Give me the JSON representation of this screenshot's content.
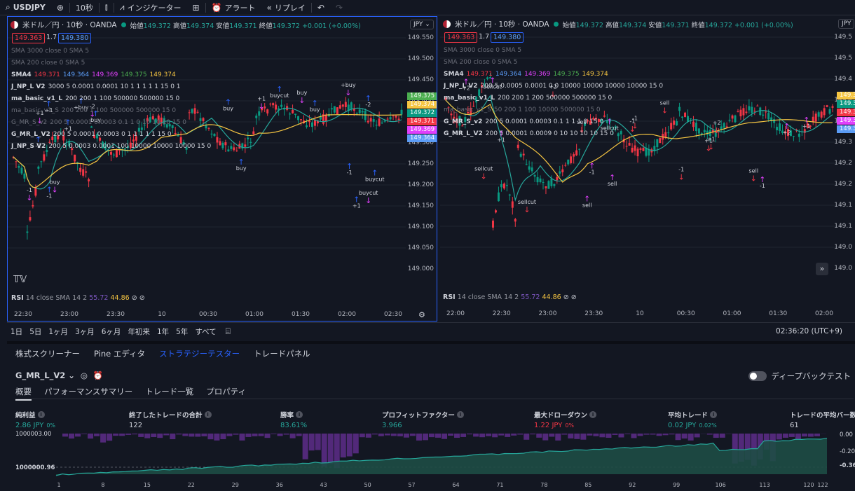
{
  "toolbar": {
    "symbol": "USDJPY",
    "interval": "10秒",
    "indicators": "インジケーター",
    "alert": "アラート",
    "replay": "リプレイ"
  },
  "left_pane": {
    "title": "米ドル／円 · 10秒 · OANDA",
    "ohlc": {
      "open_label": "始値",
      "open": "149.372",
      "high_label": "高値",
      "high": "149.374",
      "low_label": "安値",
      "low": "149.371",
      "close_label": "終値",
      "close": "149.372",
      "change": "+0.001 (+0.00%)"
    },
    "bid": "149.363",
    "spread": "1.7",
    "ask": "149.380",
    "currency": "JPY",
    "legend": [
      {
        "name": "SMA 3000 close 0 SMA 5",
        "dim": true
      },
      {
        "name": "SMA 200 close 0 SMA 5",
        "dim": true
      },
      {
        "name": "SMA4",
        "values": [
          "149.371",
          "149.364",
          "149.369",
          "149.375",
          "149.374"
        ]
      },
      {
        "name": "J_NP_L V2",
        "params": "3000 5 0.0001 0.0001 10 1 1 1 1 1 15 0 1"
      },
      {
        "name": "ma_basic_v1_L",
        "params": "200 200 1 100 500000 500000 15 0"
      },
      {
        "name": "ma_basic_v1_S",
        "params": "200 200 1 100 500000 500000 15 0",
        "dim": true
      },
      {
        "name": "G_MR_S_v2",
        "params": "200 5 0.0001 0.0003 0.1 1 0 10 10 10 15 0",
        "dim": true
      },
      {
        "name": "G_MR_L_V2",
        "params": "200 5 0.0001 0.0003 0 1 1 1 1 1 15 0"
      },
      {
        "name": "J_NP_S V2",
        "params": "200 5 0.0003 0.0001 100 10000 10000 10000 15 0"
      }
    ],
    "price_ticks": [
      "149.550",
      "149.500",
      "149.450",
      "149.400",
      "149.350",
      "149.300",
      "149.250",
      "149.200",
      "149.150",
      "149.100",
      "149.050",
      "149.000"
    ],
    "price_tags": [
      {
        "value": "149.375",
        "color": "#4caf50"
      },
      {
        "value": "149.374",
        "color": "#f5c542"
      },
      {
        "value": "149.372",
        "color": "#089981"
      },
      {
        "value": "149.371",
        "color": "#f23645"
      },
      {
        "value": "149.369",
        "color": "#e040fb"
      },
      {
        "value": "149.364",
        "color": "#5b9cf6"
      }
    ],
    "time_ticks": [
      "22:30",
      "23:00",
      "23:30",
      "10",
      "00:30",
      "01:00",
      "01:30",
      "02:00",
      "02:30"
    ],
    "rsi": {
      "label": "RSI",
      "params": "14 close SMA 14 2",
      "v1": "55.72",
      "v2": "44.86"
    },
    "annotations": [
      "buy",
      "+1",
      "buycut",
      "-1",
      "-2",
      "buy",
      "+1",
      "+buy"
    ]
  },
  "right_pane": {
    "title": "米ドル／円 · 10秒 · OANDA",
    "ohlc": {
      "open_label": "始値",
      "open": "149.372",
      "high_label": "高値",
      "high": "149.374",
      "low_label": "安値",
      "low": "149.371",
      "close_label": "終値",
      "close": "149.372",
      "change": "+0.001 (+0.00%)"
    },
    "bid": "149.363",
    "spread": "1.7",
    "ask": "149.380",
    "currency": "JPY",
    "legend": [
      {
        "name": "SMA 3000 close 0 SMA 5",
        "dim": true
      },
      {
        "name": "SMA 200 close 0 SMA 5",
        "dim": true
      },
      {
        "name": "SMA4",
        "values": [
          "149.371",
          "149.364",
          "149.369",
          "149.375",
          "149.374"
        ]
      },
      {
        "name": "J_NP_L V2",
        "params": "200 5 0.0005 0.0001 0.0 10000 10000 10000 10000 15 0"
      },
      {
        "name": "ma_basic_v1_L",
        "params": "200 200 1 200 500000 500000 15 0"
      },
      {
        "name": "ma_basic_v1_S",
        "params": "50 200 1 100 10000 500000 15 0",
        "dim": true
      },
      {
        "name": "G_MR_S_v2",
        "params": "200 5 0.0001 0.0003 0.1 1 1 1 0 15 0"
      },
      {
        "name": "G_MR_L_V2",
        "params": "200 5 0.0001 0.0009 0 10 10 10 10 15 0"
      }
    ],
    "price_ticks": [
      "149.5",
      "149.5",
      "149.4",
      "149.4",
      "149.3",
      "149.3",
      "149.2",
      "149.2",
      "149.1",
      "149.1",
      "149.0",
      "149.0"
    ],
    "price_tags": [
      {
        "value": "149.3",
        "color": "#f5c542"
      },
      {
        "value": "149.3",
        "color": "#089981"
      },
      {
        "value": "149.3",
        "color": "#f23645"
      },
      {
        "value": "149.3",
        "color": "#e040fb"
      },
      {
        "value": "149.3",
        "color": "#5b9cf6"
      }
    ],
    "time_ticks": [
      "22:00",
      "22:30",
      "23:00",
      "23:30",
      "10",
      "00:30",
      "01:00",
      "01:30",
      "02:00"
    ],
    "rsi": {
      "label": "RSI",
      "params": "14 close SMA 14 2",
      "v1": "55.72",
      "v2": "44.86"
    },
    "annotations": [
      "sell",
      "-1",
      "sellcut",
      "+1",
      "+2"
    ]
  },
  "period_bar": {
    "periods": [
      "1日",
      "5日",
      "1ヶ月",
      "3ヶ月",
      "6ヶ月",
      "年初来",
      "1年",
      "5年",
      "すべて"
    ],
    "clock": "02:36:20 (UTC+9)"
  },
  "panel": {
    "tabs": [
      "株式スクリーナー",
      "Pine エディタ",
      "ストラテジーテスター",
      "トレードパネル"
    ],
    "active_tab": 2,
    "strategy_name": "G_MR_L_V2",
    "deep_backtest": "ディープバックテスト",
    "sub_tabs": [
      "概要",
      "パフォーマンスサマリー",
      "トレード一覧",
      "プロパティ"
    ],
    "active_sub_tab": 0,
    "metrics": [
      {
        "label": "純利益",
        "value": "2.86 JPY",
        "sub": "0%",
        "color": "pos"
      },
      {
        "label": "終了したトレードの合計",
        "value": "122",
        "sub": "",
        "color": "plain"
      },
      {
        "label": "勝率",
        "value": "83.61%",
        "sub": "",
        "color": "pos"
      },
      {
        "label": "プロフィットファクター",
        "value": "3.966",
        "sub": "",
        "color": "pos"
      },
      {
        "label": "最大ドローダウン",
        "value": "1.22 JPY",
        "sub": "0%",
        "color": "neg"
      },
      {
        "label": "平均トレード",
        "value": "0.02 JPY",
        "sub": "0.02%",
        "color": "pos"
      },
      {
        "label": "トレードの平均バー数",
        "value": "61",
        "sub": "",
        "color": "plain"
      }
    ],
    "equity_left_labels": [
      "1000003.00",
      "1000000.96"
    ],
    "equity_right_labels": [
      "0.00",
      "-0.20",
      "-0.36"
    ],
    "equity_x_ticks": [
      "1",
      "8",
      "15",
      "22",
      "29",
      "36",
      "43",
      "50",
      "57",
      "64",
      "71",
      "78",
      "85",
      "92",
      "99",
      "106",
      "113",
      "120",
      "122"
    ]
  },
  "colors": {
    "accent": "#2962ff",
    "up": "#089981",
    "down": "#f23645",
    "equity_fill": "#1e4d45",
    "drawdown": "#7b3fa0"
  }
}
